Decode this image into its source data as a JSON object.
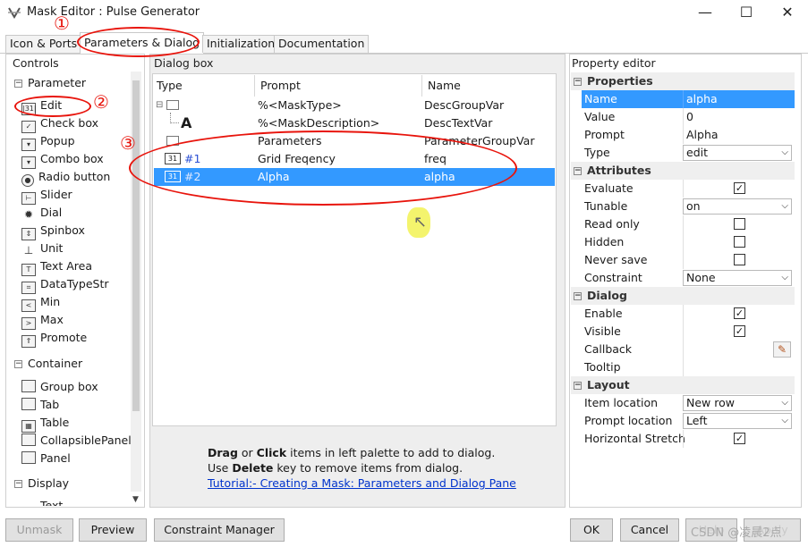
{
  "window": {
    "title": "Mask Editor : Pulse Generator",
    "minimize_glyph": "—",
    "maximize_glyph": "☐",
    "close_glyph": "✕"
  },
  "tabs": [
    {
      "label": "Icon & Ports"
    },
    {
      "label": "Parameters & Dialog",
      "active": true
    },
    {
      "label": "Initialization"
    },
    {
      "label": "Documentation"
    }
  ],
  "controls": {
    "heading": "Controls",
    "groups": {
      "parameter": "Parameter",
      "container": "Container",
      "display": "Display"
    },
    "parameter_items": [
      "Edit",
      "Check box",
      "Popup",
      "Combo box",
      "Radio button",
      "Slider",
      "Dial",
      "Spinbox",
      "Unit",
      "Text Area",
      "DataTypeStr",
      "Min",
      "Max",
      "Promote"
    ],
    "container_items": [
      "Group box",
      "Tab",
      "Table",
      "CollapsiblePanel",
      "Panel"
    ],
    "display_items": [
      "Text"
    ]
  },
  "dialog_box": {
    "heading": "Dialog box",
    "columns": [
      "Type",
      "Prompt",
      "Name"
    ],
    "rows": [
      {
        "type": "",
        "prompt": "%<MaskType>",
        "name": "DescGroupVar"
      },
      {
        "type": "A",
        "prompt": "%<MaskDescription>",
        "name": "DescTextVar"
      },
      {
        "type": "",
        "prompt": "Parameters",
        "name": "ParameterGroupVar"
      },
      {
        "type": "#1",
        "prompt": "Grid Freqency",
        "name": "freq"
      },
      {
        "type": "#2",
        "prompt": "Alpha",
        "name": "alpha",
        "selected": true
      }
    ],
    "help": {
      "drag": "Drag",
      "or": " or ",
      "click": "Click",
      "line1_rest": " items in left palette to add to dialog.",
      "use": "Use ",
      "delete": "Delete",
      "line2_rest": " key to remove items from dialog.",
      "link": "Tutorial:- Creating a Mask: Parameters and Dialog Pane"
    }
  },
  "property_editor": {
    "heading": "Property editor",
    "sections": {
      "properties": "Properties",
      "attributes": "Attributes",
      "dialog": "Dialog",
      "layout": "Layout"
    },
    "properties": [
      {
        "key": "Name",
        "value": "alpha"
      },
      {
        "key": "Value",
        "value": "0"
      },
      {
        "key": "Prompt",
        "value": "Alpha"
      },
      {
        "key": "Type",
        "value": "edit"
      }
    ],
    "attributes": [
      {
        "key": "Evaluate",
        "checked": true
      },
      {
        "key": "Tunable",
        "value": "on"
      },
      {
        "key": "Read only",
        "checked": false
      },
      {
        "key": "Hidden",
        "checked": false
      },
      {
        "key": "Never save",
        "checked": false
      },
      {
        "key": "Constraint",
        "value": "None"
      }
    ],
    "dialog": [
      {
        "key": "Enable",
        "checked": true
      },
      {
        "key": "Visible",
        "checked": true
      },
      {
        "key": "Callback"
      },
      {
        "key": "Tooltip"
      }
    ],
    "layout": [
      {
        "key": "Item location",
        "value": "New row"
      },
      {
        "key": "Prompt location",
        "value": "Left"
      },
      {
        "key": "Horizontal Stretch",
        "checked": true
      }
    ]
  },
  "buttons": {
    "unmask": "Unmask",
    "preview": "Preview",
    "constraint_manager": "Constraint Manager",
    "ok": "OK",
    "cancel": "Cancel",
    "help": "Help",
    "apply": "Apply"
  },
  "annotations": {
    "n1": "①",
    "n2": "②",
    "n3": "③",
    "color": "#e8140c"
  },
  "watermark": "CSDN @凌晨2点"
}
